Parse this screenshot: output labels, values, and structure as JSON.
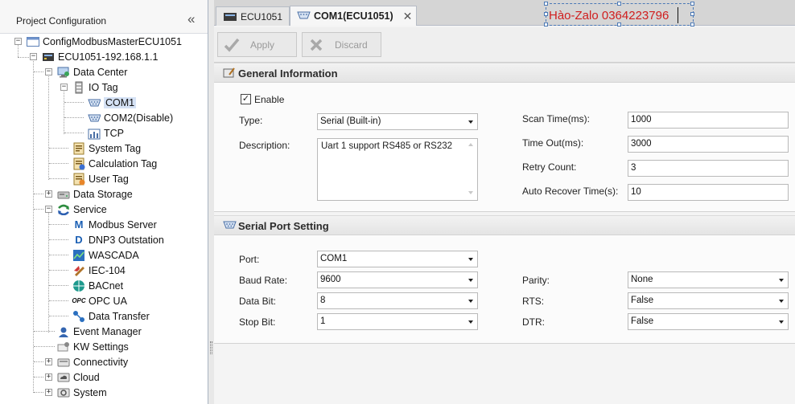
{
  "left_panel": {
    "title": "Project Configuration",
    "collapse_glyph": "«",
    "tree": [
      {
        "label": "ConfigModbusMasterECU1051",
        "icon": "project-icon"
      },
      {
        "label": "ECU1051-192.168.1.1",
        "icon": "device-icon"
      },
      {
        "label": "Data Center",
        "icon": "data-center-icon"
      },
      {
        "label": "IO Tag",
        "icon": "io-tag-icon"
      },
      {
        "label": "COM1",
        "icon": "serial-port-icon"
      },
      {
        "label": "COM2(Disable)",
        "icon": "serial-port-icon"
      },
      {
        "label": "TCP",
        "icon": "tcp-icon"
      },
      {
        "label": "System Tag",
        "icon": "system-tag-icon"
      },
      {
        "label": "Calculation Tag",
        "icon": "calculation-tag-icon"
      },
      {
        "label": "User Tag",
        "icon": "user-tag-icon"
      },
      {
        "label": "Data Storage",
        "icon": "data-storage-icon"
      },
      {
        "label": "Service",
        "icon": "service-icon"
      },
      {
        "label": "Modbus Server",
        "icon": "modbus-icon"
      },
      {
        "label": "DNP3 Outstation",
        "icon": "dnp3-icon"
      },
      {
        "label": "WASCADA",
        "icon": "wascada-icon"
      },
      {
        "label": "IEC-104",
        "icon": "iec104-icon"
      },
      {
        "label": "BACnet",
        "icon": "bacnet-icon"
      },
      {
        "label": "OPC UA",
        "icon": "opcua-icon"
      },
      {
        "label": "Data Transfer",
        "icon": "data-transfer-icon"
      },
      {
        "label": "Event Manager",
        "icon": "event-manager-icon"
      },
      {
        "label": "KW Settings",
        "icon": "kw-settings-icon"
      },
      {
        "label": "Connectivity",
        "icon": "connectivity-icon"
      },
      {
        "label": "Cloud",
        "icon": "cloud-icon"
      },
      {
        "label": "System",
        "icon": "system-icon"
      }
    ]
  },
  "tabs": [
    {
      "label": "ECU1051",
      "active": false
    },
    {
      "label": "COM1(ECU1051)",
      "active": true,
      "close_glyph": "✕"
    }
  ],
  "watermark": {
    "text": "Hào-Zalo 0364223796",
    "color": "#d01d1d"
  },
  "toolbar": {
    "apply_label": "Apply",
    "discard_label": "Discard"
  },
  "general": {
    "title": "General Information",
    "enable_label": "Enable",
    "enable_checked": true,
    "type_label": "Type:",
    "type_value": "Serial (Built-in)",
    "description_label": "Description:",
    "description_value": "Uart 1 support RS485 or RS232",
    "scan_time_label": "Scan Time(ms):",
    "scan_time_value": "1000",
    "time_out_label": "Time Out(ms):",
    "time_out_value": "3000",
    "retry_count_label": "Retry Count:",
    "retry_count_value": "3",
    "auto_recover_label": "Auto Recover Time(s):",
    "auto_recover_value": "10"
  },
  "serial": {
    "title": "Serial Port Setting",
    "port_label": "Port:",
    "port_value": "COM1",
    "baud_label": "Baud Rate:",
    "baud_value": "9600",
    "databit_label": "Data Bit:",
    "databit_value": "8",
    "stopbit_label": "Stop Bit:",
    "stopbit_value": "1",
    "parity_label": "Parity:",
    "parity_value": "None",
    "rts_label": "RTS:",
    "rts_value": "False",
    "dtr_label": "DTR:",
    "dtr_value": "False"
  },
  "colors": {
    "accent": "#4a78b5",
    "selection": "#d5e2f5",
    "watermark_text": "#d01d1d"
  }
}
